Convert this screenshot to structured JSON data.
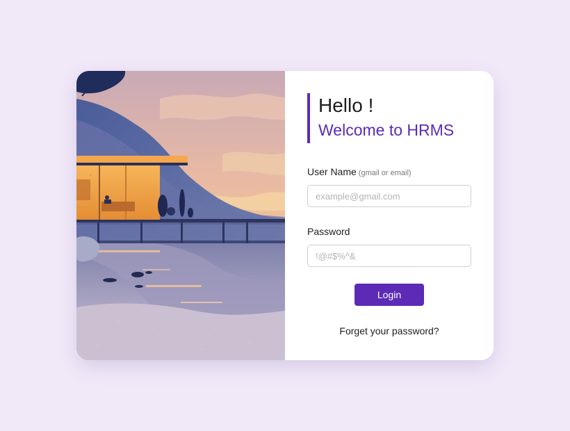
{
  "illustration": {
    "description_icon": "lake-house-illustration"
  },
  "heading": {
    "greeting": "Hello !",
    "welcome": "Welcome to HRMS"
  },
  "username": {
    "label": "User Name",
    "hint": "(gmail or email)",
    "placeholder": "example@gmail.com",
    "value": ""
  },
  "password": {
    "label": "Password",
    "placeholder": "!@#$%^&",
    "value": ""
  },
  "login": {
    "label": "Login"
  },
  "forgot": {
    "label": "Forget your password?"
  },
  "colors": {
    "background": "#f1e9f8",
    "accent": "#5b2bb6",
    "card": "#ffffff"
  }
}
